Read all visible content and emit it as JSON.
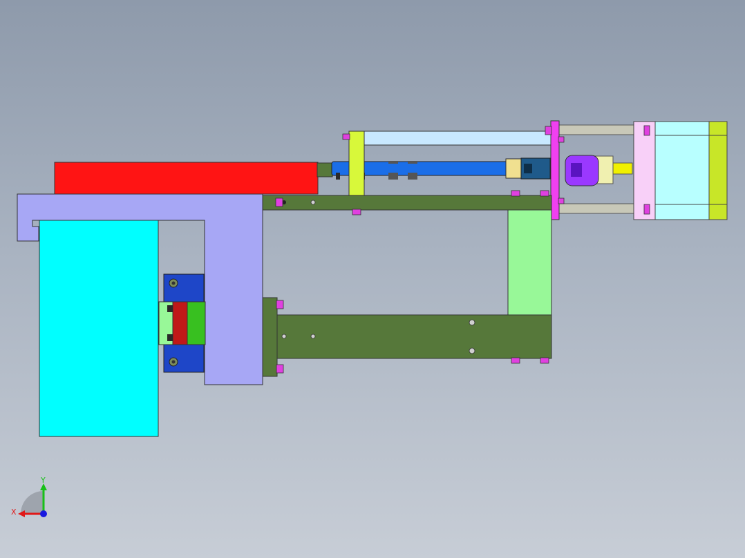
{
  "viewport": {
    "background_top": "#8e9aab",
    "background_bottom": "#c7cdd6"
  },
  "assembly": {
    "colors": {
      "red_block": "#ff1414",
      "base_bracket": "#a7a7f5",
      "cyan_block": "#00ffff",
      "frame_plate": "#56783a",
      "light_green_post": "#98f898",
      "lime_plate": "#d8f83a",
      "magenta_plate": "#f040f0",
      "screw_rod": "#1a6ee8",
      "guide_rods": "#c8c8b8",
      "top_light_bar": "#c8e8ff",
      "motor_body": "#b8ffff",
      "motor_flange": "#f8d0f8",
      "motor_end_cap": "#c8e628",
      "coupling": "#9a38ff",
      "nut_block": "#1f5a8a",
      "bearing_block": "#1e46c8",
      "slider_green": "#38c020",
      "slider_red": "#c01818"
    }
  },
  "triad": {
    "x_label": "X",
    "y_label": "Y",
    "x_color": "#e01818",
    "y_color": "#18c018",
    "z_color": "#1818e0"
  }
}
